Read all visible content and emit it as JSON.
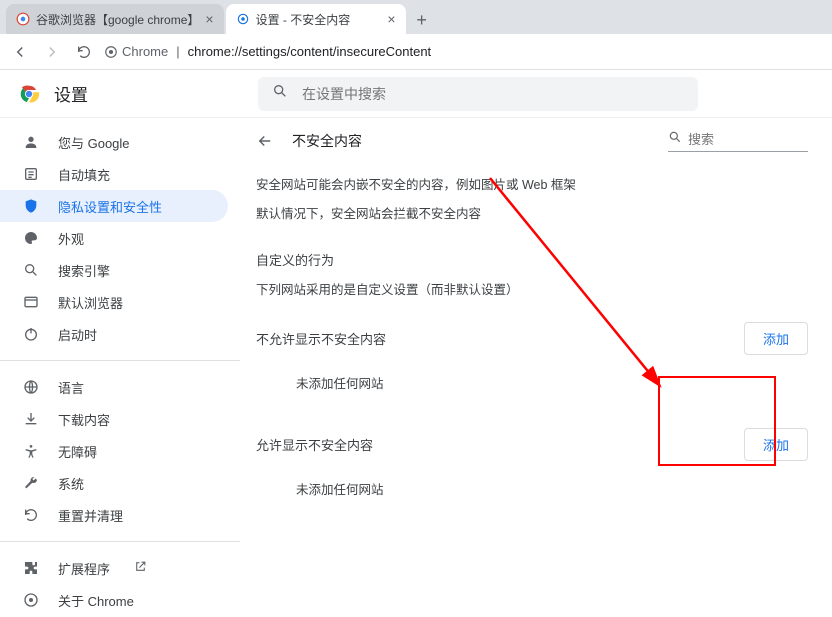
{
  "tabs": [
    {
      "title": "谷歌浏览器【google chrome】",
      "active": false
    },
    {
      "title": "设置 - 不安全内容",
      "active": true
    }
  ],
  "address": {
    "protocol_label": "Chrome",
    "url_path": "chrome://settings/content/insecureContent"
  },
  "header": {
    "app_title": "设置",
    "global_search_placeholder": "在设置中搜索"
  },
  "sidebar": {
    "groups": [
      [
        {
          "icon": "person",
          "label": "您与 Google"
        },
        {
          "icon": "autofill",
          "label": "自动填充"
        },
        {
          "icon": "shield",
          "label": "隐私设置和安全性",
          "active": true
        },
        {
          "icon": "palette",
          "label": "外观"
        },
        {
          "icon": "search",
          "label": "搜索引擎"
        },
        {
          "icon": "browser",
          "label": "默认浏览器"
        },
        {
          "icon": "power",
          "label": "启动时"
        }
      ],
      [
        {
          "icon": "globe",
          "label": "语言"
        },
        {
          "icon": "download",
          "label": "下载内容"
        },
        {
          "icon": "a11y",
          "label": "无障碍"
        },
        {
          "icon": "wrench",
          "label": "系统"
        },
        {
          "icon": "reset",
          "label": "重置并清理"
        }
      ],
      [
        {
          "icon": "puzzle",
          "label": "扩展程序",
          "external": true
        },
        {
          "icon": "chrome",
          "label": "关于 Chrome"
        }
      ]
    ]
  },
  "main": {
    "page_title": "不安全内容",
    "search_placeholder": "搜索",
    "desc1": "安全网站可能会内嵌不安全的内容，例如图片或 Web 框架",
    "desc2": "默认情况下，安全网站会拦截不安全内容",
    "custom_heading": "自定义的行为",
    "custom_sub": "下列网站采用的是自定义设置（而非默认设置）",
    "block_section": {
      "title": "不允许显示不安全内容",
      "add_label": "添加",
      "empty": "未添加任何网站"
    },
    "allow_section": {
      "title": "允许显示不安全内容",
      "add_label": "添加",
      "empty": "未添加任何网站"
    }
  }
}
